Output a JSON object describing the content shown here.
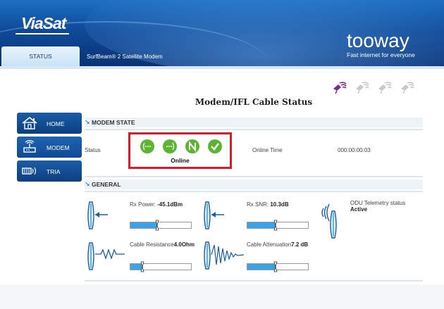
{
  "header": {
    "brand": "ViaSat",
    "product_name": "tooway",
    "product_tagline": "Fast internet for everyone",
    "device_name": "SurfBeam® 2 Satellite Modem",
    "tab_status": "STATUS"
  },
  "page_title": "Modem/IFL Cable Status",
  "sidebar": {
    "items": [
      {
        "label": "HOME",
        "icon": "home-icon"
      },
      {
        "label": "MODEM",
        "icon": "modem-icon"
      },
      {
        "label": "TRIA",
        "icon": "tria-icon"
      }
    ]
  },
  "modem_state": {
    "section_title": "MODEM STATE",
    "status_label": "Status",
    "status_value": "Online",
    "online_time_label": "Online Time",
    "online_time_value": "000:00:00:03"
  },
  "general": {
    "section_title": "GENERAL",
    "rx_power_label": "Rx Power:",
    "rx_power_value": "-45.1dBm",
    "rx_power_level": 0.44,
    "rx_snr_label": "Rx SNR:",
    "rx_snr_value": "10.3dB",
    "rx_snr_level": 0.47,
    "odu_label": "ODU Telemetry status",
    "odu_value": "Active",
    "cable_resistance_label": "Cable Resistance",
    "cable_resistance_value": "4.0Ohm",
    "cable_resistance_level": 0.2,
    "cable_attenuation_label": "Cable Attenuation",
    "cable_attenuation_value": "7.2 dB",
    "cable_attenuation_level": 0.47
  },
  "colors": {
    "header_blue": "#0f4a98",
    "bar_fill": "#39a3e6",
    "highlight_red": "#d81d2a",
    "status_green": "#5cb531"
  }
}
